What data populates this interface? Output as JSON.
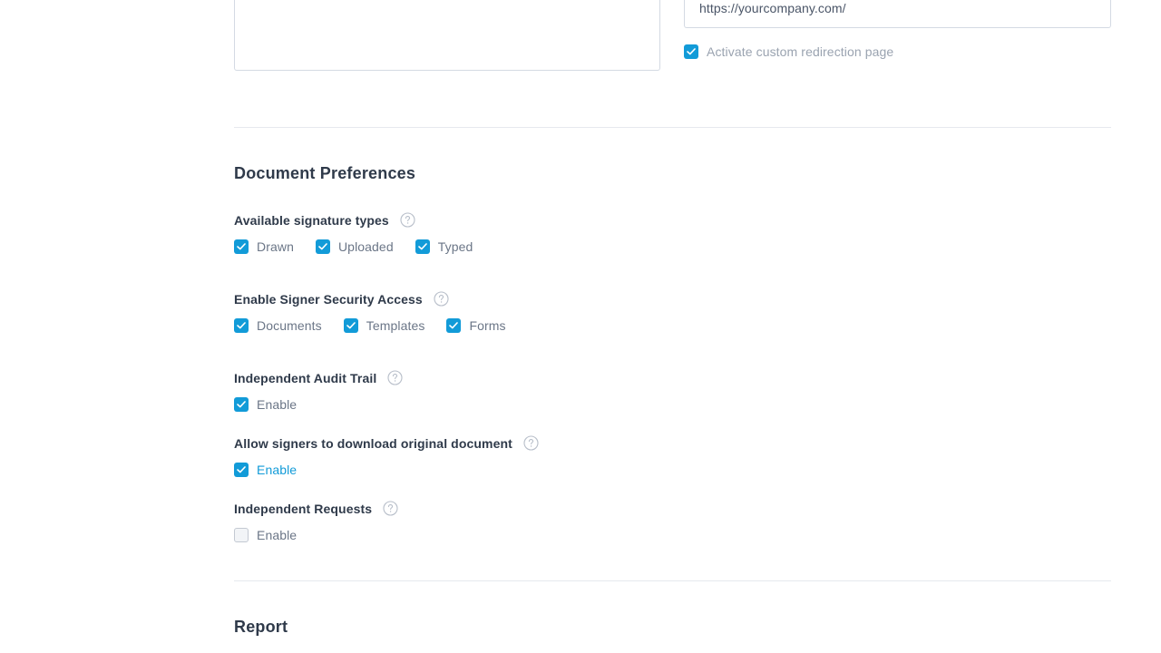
{
  "redirect": {
    "url_value": "https://yourcompany.com/",
    "activate_label": "Activate custom redirection page",
    "activate_checked": true
  },
  "document_preferences": {
    "title": "Document Preferences",
    "signature_types": {
      "label": "Available signature types",
      "options": [
        {
          "label": "Drawn",
          "checked": true
        },
        {
          "label": "Uploaded",
          "checked": true
        },
        {
          "label": "Typed",
          "checked": true
        }
      ]
    },
    "signer_security": {
      "label": "Enable Signer Security Access",
      "options": [
        {
          "label": "Documents",
          "checked": true
        },
        {
          "label": "Templates",
          "checked": true
        },
        {
          "label": "Forms",
          "checked": true
        }
      ]
    },
    "audit_trail": {
      "label": "Independent Audit Trail",
      "option": {
        "label": "Enable",
        "checked": true
      }
    },
    "download_original": {
      "label": "Allow signers to download original document",
      "option": {
        "label": "Enable",
        "checked": true
      }
    },
    "independent_requests": {
      "label": "Independent Requests",
      "option": {
        "label": "Enable",
        "checked": false
      }
    }
  },
  "report": {
    "title": "Report"
  },
  "colors": {
    "accent": "#129bd8",
    "text_dark": "#2f3a4a",
    "text_muted": "#6b7687",
    "border": "#d4dae3"
  },
  "icons": {
    "check": "check-icon",
    "help": "help-circle-icon"
  }
}
